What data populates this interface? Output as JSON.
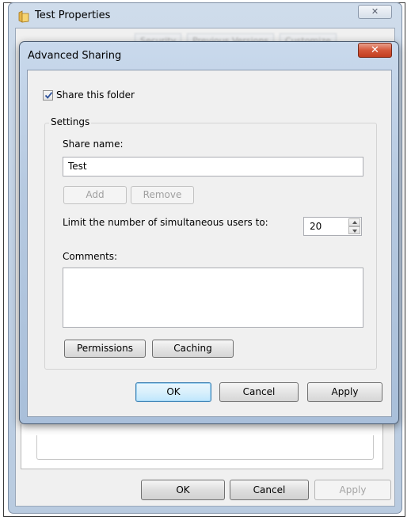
{
  "background_window": {
    "title": "Test Properties",
    "close_label": "✕",
    "tabs": [
      "Security",
      "Previous Versions",
      "Customize"
    ],
    "buttons": {
      "ok": "OK",
      "cancel": "Cancel",
      "apply": "Apply"
    }
  },
  "dialog": {
    "title": "Advanced Sharing",
    "close_label": "✕",
    "share_checkbox": {
      "label": "Share this folder",
      "checked": true
    },
    "settings": {
      "legend": "Settings",
      "share_name_label": "Share name:",
      "share_name_value": "Test",
      "add_label": "Add",
      "remove_label": "Remove",
      "limit_label": "Limit the number of simultaneous users to:",
      "limit_value": "20",
      "comments_label": "Comments:",
      "comments_value": "",
      "permissions_label": "Permissions",
      "caching_label": "Caching"
    },
    "buttons": {
      "ok": "OK",
      "cancel": "Cancel",
      "apply": "Apply"
    }
  },
  "icons": {
    "folder": "folder-icon",
    "close": "close-icon",
    "check": "checkmark-icon",
    "spin_up": "arrow-up-icon",
    "spin_down": "arrow-down-icon"
  },
  "colors": {
    "title_bar": "#bfd0e4",
    "close_button_red": "#c23d1f",
    "client_bg": "#f0f0f0",
    "default_button_border": "#3c7fb1"
  }
}
